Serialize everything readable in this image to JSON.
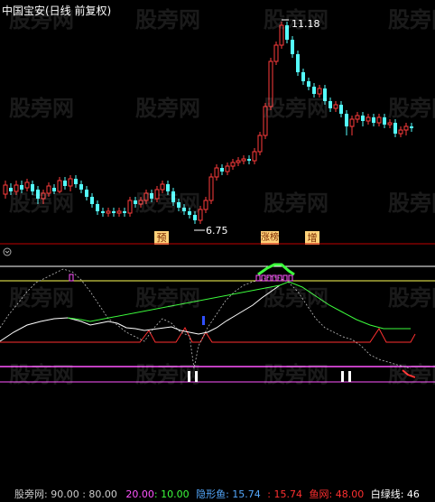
{
  "title": "中国宝安(日线 前复权)",
  "price": {
    "high_label": "11.18",
    "low_label": "6.75",
    "tags": {
      "yu": "预",
      "lb": "涨榜",
      "zeng": "增"
    }
  },
  "indicator": {
    "name": "股旁网",
    "params": ": 90.00 : 80.00",
    "v1": "20.00",
    "v2": ": 10.00",
    "yinxingyu": "隐形鱼: 15.74",
    "v3": ": 15.74",
    "yuwang": "鱼网: 48.00",
    "bailvxian": "白绿线: 46"
  },
  "watermark": "股旁网",
  "colors": {
    "up": "#ff3c3c",
    "down": "#54fcfc",
    "white": "#ffffff",
    "green": "#3cfc3c",
    "magenta": "#ff54ff",
    "yellow": "#ffff54"
  }
}
